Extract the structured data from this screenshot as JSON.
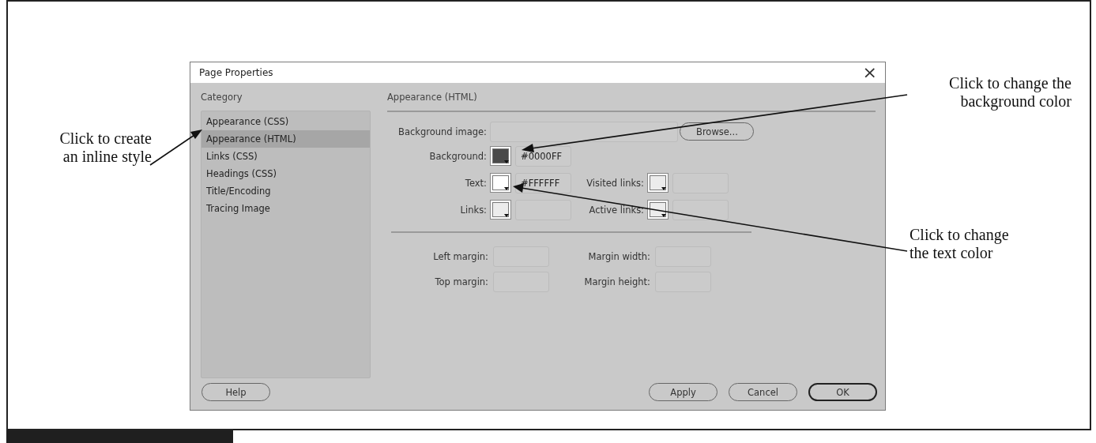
{
  "window": {
    "title": "Page Properties",
    "close": "×"
  },
  "category": {
    "label": "Category",
    "items": [
      {
        "label": "Appearance (CSS)",
        "selected": false
      },
      {
        "label": "Appearance (HTML)",
        "selected": true
      },
      {
        "label": "Links (CSS)",
        "selected": false
      },
      {
        "label": "Headings (CSS)",
        "selected": false
      },
      {
        "label": "Title/Encoding",
        "selected": false
      },
      {
        "label": "Tracing Image",
        "selected": false
      }
    ]
  },
  "panel": {
    "heading": "Appearance (HTML)",
    "background_image": {
      "label": "Background image:",
      "button": "Browse..."
    },
    "color_rows": [
      [
        {
          "label": "Background:",
          "color": "#4a4a4a",
          "value": "#0000FF"
        }
      ],
      [
        {
          "label": "Text:",
          "color": "#ffffff",
          "value": "#FFFFFF"
        },
        {
          "label": "Visited links:",
          "color": "#ececec"
        }
      ],
      [
        {
          "label": "Links:",
          "color": "#ececec"
        },
        {
          "label": "Active links:",
          "color": "#ececec"
        }
      ]
    ],
    "margin_rows": [
      [
        {
          "label": "Left margin:"
        },
        {
          "label": "Margin width:"
        }
      ],
      [
        {
          "label": "Top margin:"
        },
        {
          "label": "Margin height:"
        }
      ]
    ]
  },
  "buttons_left": [
    {
      "label": "Help",
      "default": false
    }
  ],
  "buttons_right": [
    {
      "label": "Apply",
      "default": false
    },
    {
      "label": "Cancel",
      "default": false
    },
    {
      "label": "OK",
      "default": true
    }
  ],
  "annotations_left": [
    {
      "text": "Click to create\nan inline style"
    }
  ],
  "annotations_right": [
    {
      "text": "Click to change the\nbackground color"
    },
    {
      "text": "Click to change\nthe text color"
    }
  ]
}
